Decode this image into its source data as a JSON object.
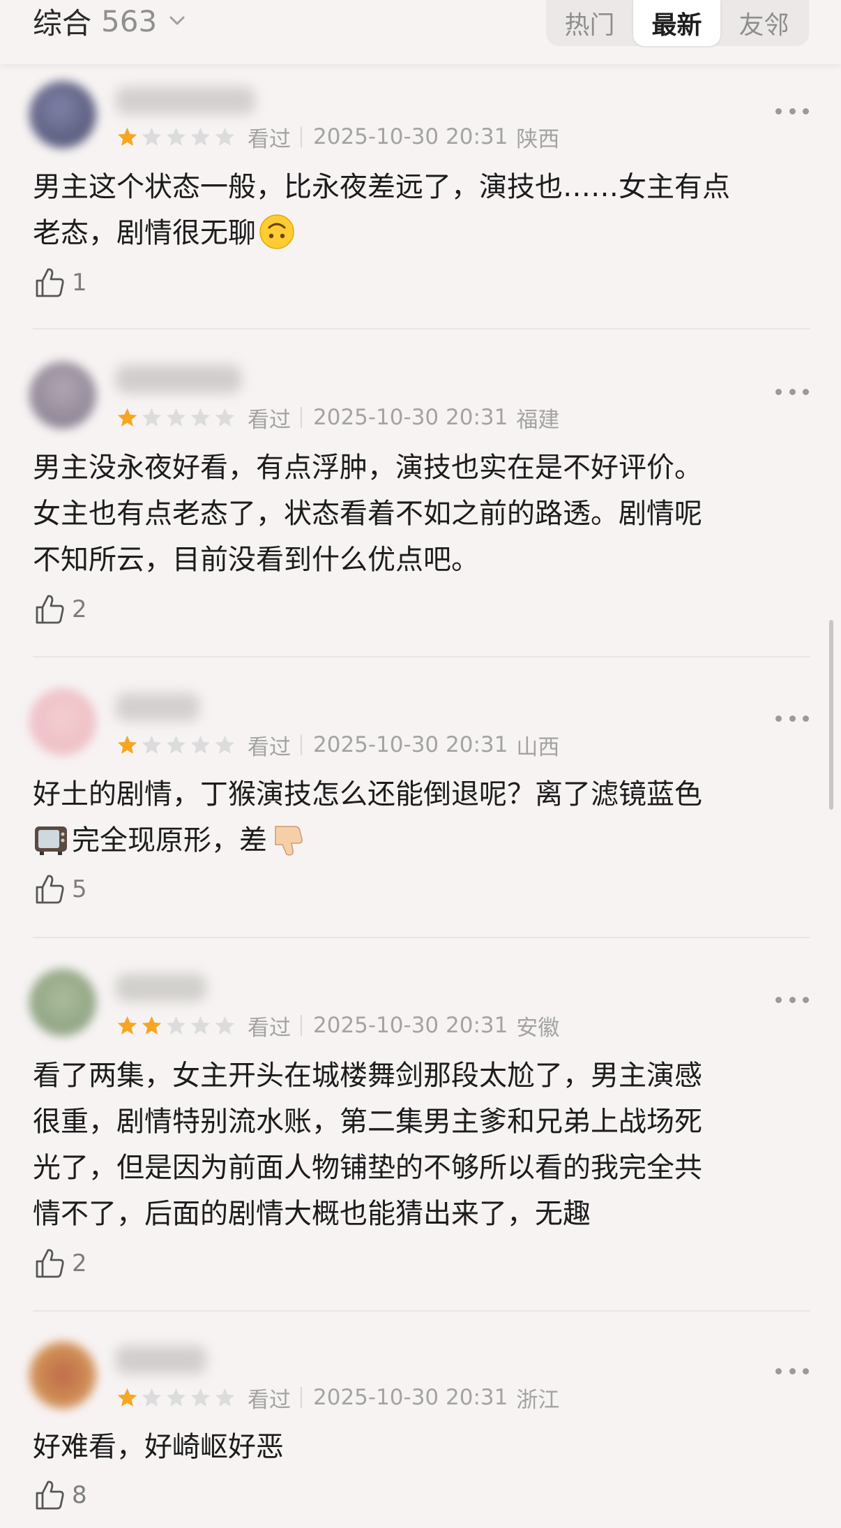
{
  "header": {
    "title": "综合",
    "count": "563",
    "tabs": [
      {
        "label": "热门",
        "active": false
      },
      {
        "label": "最新",
        "active": true
      },
      {
        "label": "友邻",
        "active": false
      }
    ]
  },
  "comments": [
    {
      "rating": 1,
      "status": "看过",
      "datetime": "2025-10-30 20:31",
      "region": "陕西",
      "text_lines": [
        "男主这个状态一般，比永夜差远了，演技也……女主有点",
        "老态，剧情很无聊"
      ],
      "emoji": "upside-down-face",
      "likes": "1"
    },
    {
      "rating": 1,
      "status": "看过",
      "datetime": "2025-10-30 20:31",
      "region": "福建",
      "text_lines": [
        "男主没永夜好看，有点浮肿，演技也实在是不好评价。",
        "女主也有点老态了，状态看着不如之前的路透。剧情呢",
        "不知所云，目前没看到什么优点吧。"
      ],
      "likes": "2"
    },
    {
      "rating": 1,
      "status": "看过",
      "datetime": "2025-10-30 20:31",
      "region": "山西",
      "text_lines": [
        "好土的剧情，丁猴演技怎么还能倒退呢？离了滤镜蓝色",
        "完全现原形，差"
      ],
      "emoji_start": "tv",
      "emoji_end": "thumbs-down",
      "likes": "5"
    },
    {
      "rating": 2,
      "status": "看过",
      "datetime": "2025-10-30 20:31",
      "region": "安徽",
      "text_lines": [
        "看了两集，女主开头在城楼舞剑那段太尬了，男主演感",
        "很重，剧情特别流水账，第二集男主爹和兄弟上战场死",
        "光了，但是因为前面人物铺垫的不够所以看的我完全共",
        "情不了，后面的剧情大概也能猜出来了，无趣"
      ],
      "likes": "2"
    },
    {
      "rating": 1,
      "status": "看过",
      "datetime": "2025-10-30 20:31",
      "region": "浙江",
      "text_lines": [
        "好难看，好崎岖好恶"
      ],
      "likes": "8"
    }
  ],
  "icons": {
    "star_filled": "star-icon",
    "star_empty": "star-outline-icon",
    "like": "thumbs-up-icon",
    "more": "more-icon"
  },
  "colors": {
    "star": "#f5a623",
    "star_empty": "#dcdcdc",
    "background": "#f7f3f3"
  }
}
